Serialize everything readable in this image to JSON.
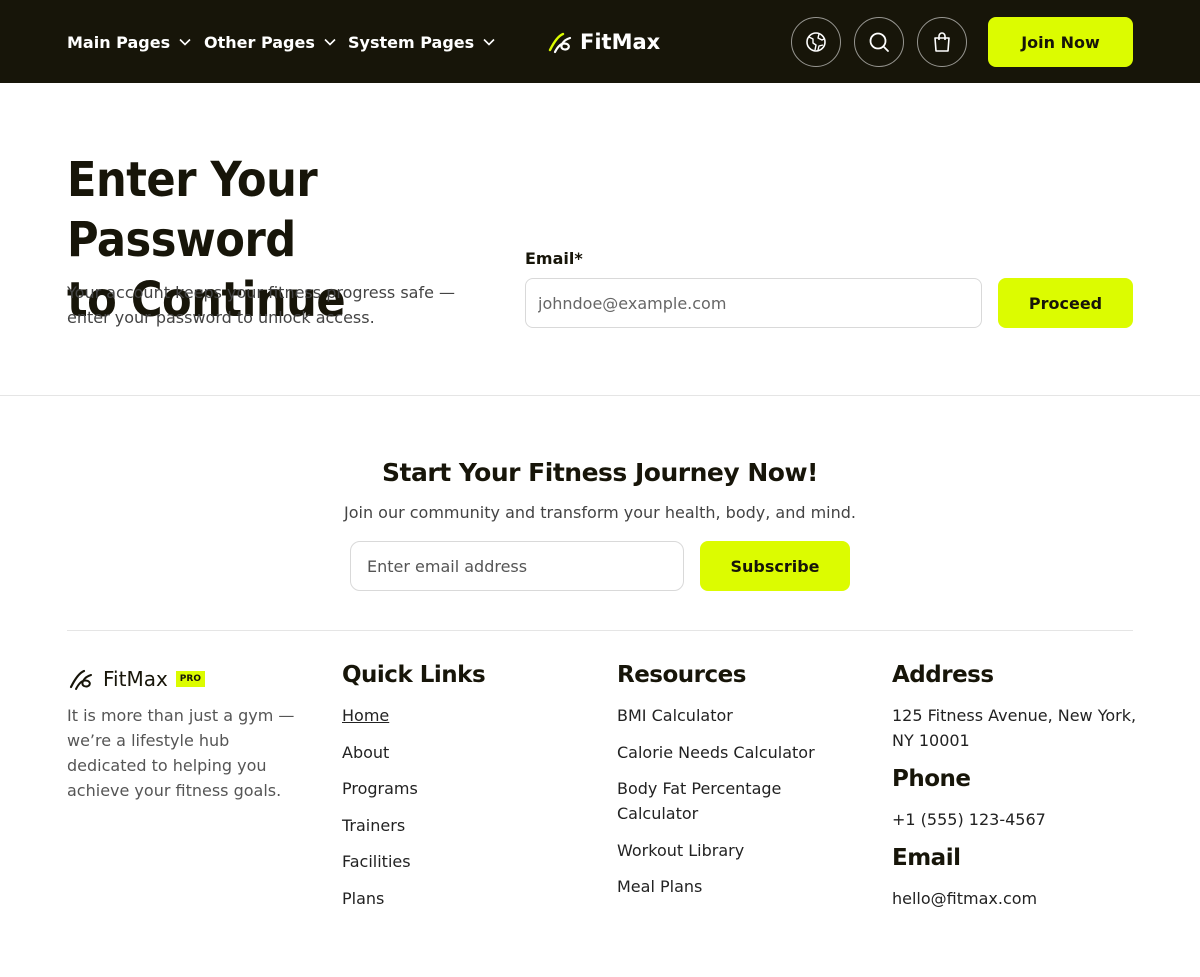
{
  "header": {
    "nav": [
      {
        "label": "Main Pages"
      },
      {
        "label": "Other Pages"
      },
      {
        "label": "System Pages"
      }
    ],
    "brand": "FitMax",
    "icons": [
      "globe-icon",
      "search-icon",
      "shopping-bag-icon"
    ],
    "join_label": "Join Now"
  },
  "hero": {
    "title_line1": "Enter Your Password",
    "title_line2": "to Continue",
    "description": "Your account keeps your fitness progress safe — enter your password to unlock access.",
    "email_label": "Email*",
    "email_placeholder": "johndoe@example.com",
    "proceed_label": "Proceed"
  },
  "cta": {
    "title": "Start Your Fitness Journey Now!",
    "description": "Join our community and transform your health, body, and mind.",
    "input_placeholder": "Enter email address",
    "button_label": "Subscribe"
  },
  "footer": {
    "brand": "FitMax",
    "badge": "PRO",
    "description": "It is more than just a gym — we’re a lifestyle hub dedicated to helping you achieve your fitness goals.",
    "quick_links": {
      "title": "Quick Links",
      "items": [
        "Home",
        "About",
        "Programs",
        "Trainers",
        "Facilities",
        "Plans"
      ]
    },
    "resources": {
      "title": "Resources",
      "items": [
        "BMI Calculator",
        "Calorie Needs Calculator",
        "Body Fat Percentage Calculator",
        "Workout Library",
        "Meal Plans"
      ]
    },
    "address": {
      "title": "Address",
      "value": "125 Fitness Avenue, New York, NY 10001"
    },
    "phone": {
      "title": "Phone",
      "value": "+1 (555) 123-4567"
    },
    "email": {
      "title": "Email",
      "value": "hello@fitmax.com"
    }
  },
  "colors": {
    "accent": "#dcfc00",
    "header_bg": "#171509"
  }
}
